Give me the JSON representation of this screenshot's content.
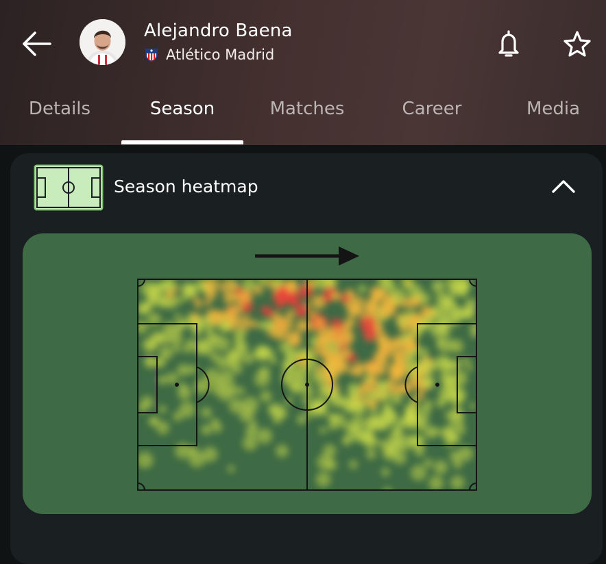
{
  "player": {
    "name": "Alejandro Baena",
    "team": "Atlético Madrid"
  },
  "header": {
    "back_icon": "arrow-left-icon",
    "bell_icon": "bell-icon",
    "star_icon": "star-icon"
  },
  "tabs": [
    {
      "label": "Details",
      "active": false
    },
    {
      "label": "Season",
      "active": true
    },
    {
      "label": "Matches",
      "active": false
    },
    {
      "label": "Career",
      "active": false
    },
    {
      "label": "Media",
      "active": false
    }
  ],
  "heatmap_card": {
    "title": "Season heatmap",
    "icon": "pitch-icon",
    "collapse_icon": "chevron-up-icon",
    "attack_direction": "left-to-right"
  },
  "colors": {
    "header_bg": "#43302f",
    "card_bg": "#1a1f21",
    "pitch_panel": "#3e6a45",
    "heat_low": "#c8d94a",
    "heat_mid": "#f0b53c",
    "heat_high": "#e8403a",
    "icon_pitch_fill": "#c9ecbd"
  }
}
